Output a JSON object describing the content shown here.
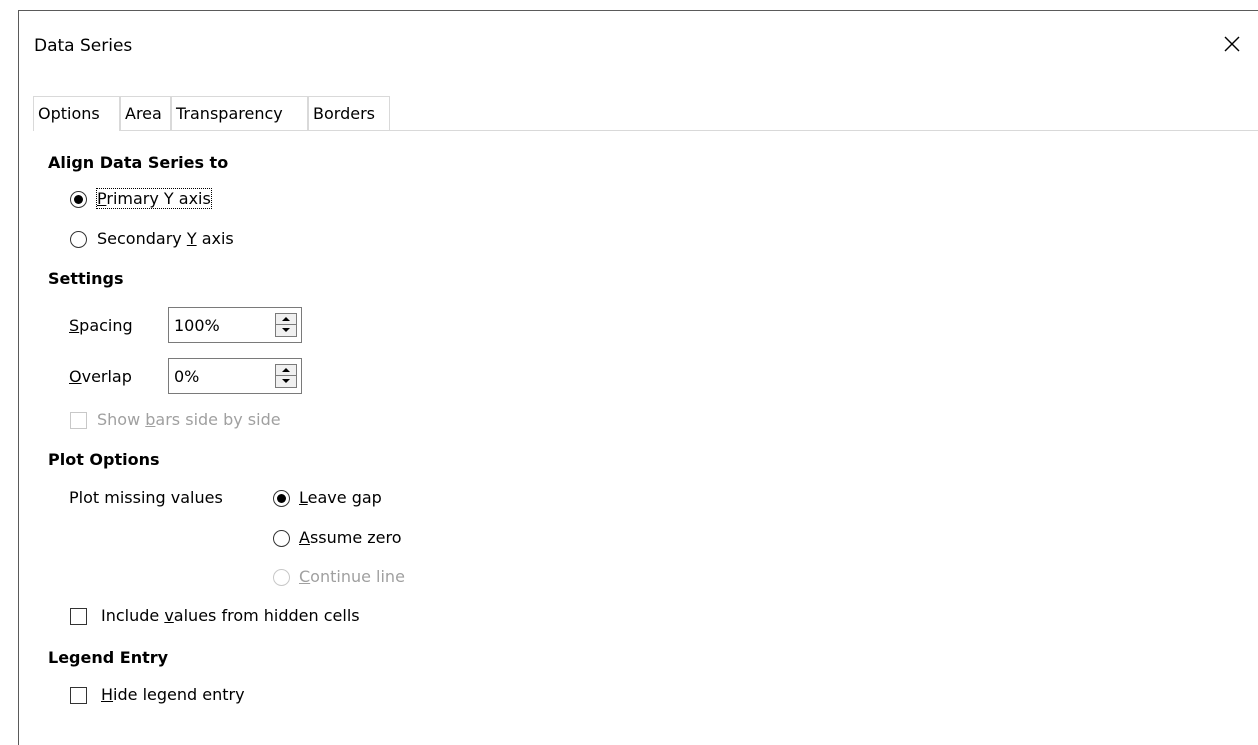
{
  "window": {
    "title": "Data Series"
  },
  "tabs": [
    {
      "label": "Options",
      "active": true
    },
    {
      "label": "Area",
      "active": false
    },
    {
      "label": "Transparency",
      "active": false
    },
    {
      "label": "Borders",
      "active": false
    }
  ],
  "align": {
    "title": "Align Data Series to",
    "primary": {
      "pre": "",
      "mnemonic": "P",
      "post": "rimary Y axis",
      "checked": true
    },
    "secondary": {
      "pre": "Secondary ",
      "mnemonic": "Y",
      "post": " axis",
      "checked": false
    }
  },
  "settings": {
    "title": "Settings",
    "spacing": {
      "mnemonic": "S",
      "label_rest": "pacing",
      "value": "100%"
    },
    "overlap": {
      "mnemonic": "O",
      "label_rest": "verlap",
      "value": "0%"
    },
    "side_by_side": {
      "pre": "Show ",
      "mnemonic": "b",
      "post": "ars side by side",
      "checked": false,
      "enabled": false
    }
  },
  "plot_options": {
    "title": "Plot Options",
    "missing_label": "Plot missing values",
    "leave_gap": {
      "mnemonic": "L",
      "post": "eave gap",
      "checked": true
    },
    "assume_zero": {
      "mnemonic": "A",
      "post": "ssume zero",
      "checked": false
    },
    "continue_line": {
      "mnemonic": "C",
      "post": "ontinue line",
      "checked": false,
      "enabled": false
    },
    "include_hidden": {
      "pre": "Include ",
      "mnemonic": "v",
      "post": "alues from hidden cells",
      "checked": false
    }
  },
  "legend": {
    "title": "Legend Entry",
    "hide": {
      "mnemonic": "H",
      "post": "ide legend entry",
      "checked": false
    }
  }
}
